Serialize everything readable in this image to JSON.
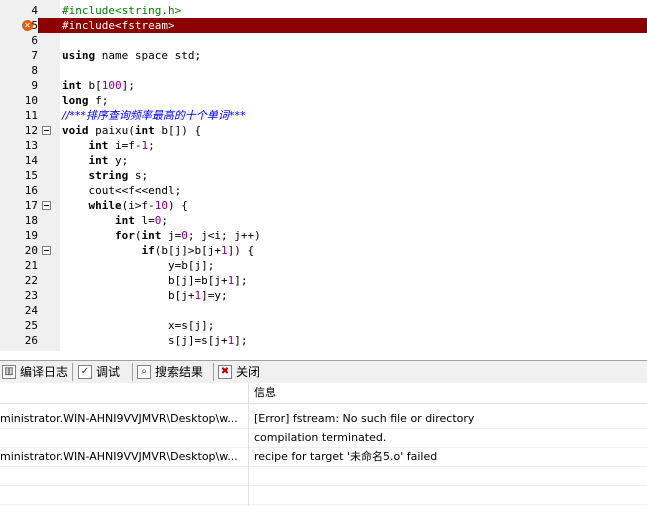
{
  "editor": {
    "lines": [
      {
        "n": "4",
        "text": "#include<string.h>",
        "kind": "pre"
      },
      {
        "n": "5",
        "text": "#include<fstream>",
        "kind": "error"
      },
      {
        "n": "6",
        "text": "",
        "kind": "plain"
      },
      {
        "n": "7",
        "text": "using name space std;",
        "kind": "plain"
      },
      {
        "n": "8",
        "text": "",
        "kind": "plain"
      },
      {
        "n": "9",
        "text": "int b[100];",
        "kind": "plain"
      },
      {
        "n": "10",
        "text": "long f;",
        "kind": "plain"
      },
      {
        "n": "11",
        "text": "//***排序查询频率最高的十个单词***",
        "kind": "comment"
      },
      {
        "n": "12",
        "text": "void paixu(int b[]) {",
        "kind": "plain",
        "fold": true
      },
      {
        "n": "13",
        "text": "    int i=f-1;",
        "kind": "plain"
      },
      {
        "n": "14",
        "text": "    int y;",
        "kind": "plain"
      },
      {
        "n": "15",
        "text": "    string s;",
        "kind": "plain"
      },
      {
        "n": "16",
        "text": "    cout<<f<<endl;",
        "kind": "plain"
      },
      {
        "n": "17",
        "text": "    while(i>f-10) {",
        "kind": "plain",
        "fold": true
      },
      {
        "n": "18",
        "text": "        int l=0;",
        "kind": "plain"
      },
      {
        "n": "19",
        "text": "        for(int j=0; j<i; j++)",
        "kind": "plain"
      },
      {
        "n": "20",
        "text": "            if(b[j]>b[j+1]) {",
        "kind": "plain",
        "fold": true
      },
      {
        "n": "21",
        "text": "                y=b[j];",
        "kind": "plain"
      },
      {
        "n": "22",
        "text": "                b[j]=b[j+1];",
        "kind": "plain"
      },
      {
        "n": "23",
        "text": "                b[j+1]=y;",
        "kind": "plain"
      },
      {
        "n": "24",
        "text": "",
        "kind": "plain"
      },
      {
        "n": "25",
        "text": "                x=s[j];",
        "kind": "plain"
      },
      {
        "n": "26",
        "text": "                s[j]=s[j+1];",
        "kind": "plain"
      }
    ]
  },
  "tabs": [
    {
      "label": "编译日志",
      "icon": "chart-icon"
    },
    {
      "label": "调试",
      "icon": "check-icon"
    },
    {
      "label": "搜索结果",
      "icon": "search-icon"
    },
    {
      "label": "关闭",
      "icon": "close-icon"
    }
  ],
  "grid": {
    "header_col2": "信息",
    "rows": [
      {
        "file": "ministrator.WIN-AHNI9VVJMVR\\Desktop\\w...",
        "msg": "[Error] fstream: No such file or directory"
      },
      {
        "file": "",
        "msg": "compilation terminated."
      },
      {
        "file": "ministrator.WIN-AHNI9VVJMVR\\Desktop\\w...",
        "msg": "recipe for target '未命名5.o' failed"
      }
    ]
  },
  "colors": {
    "error_line": "#8b0000",
    "keyword": "#000000",
    "number": "#800080",
    "comment": "#0000ff",
    "preprocessor": "#008000"
  }
}
